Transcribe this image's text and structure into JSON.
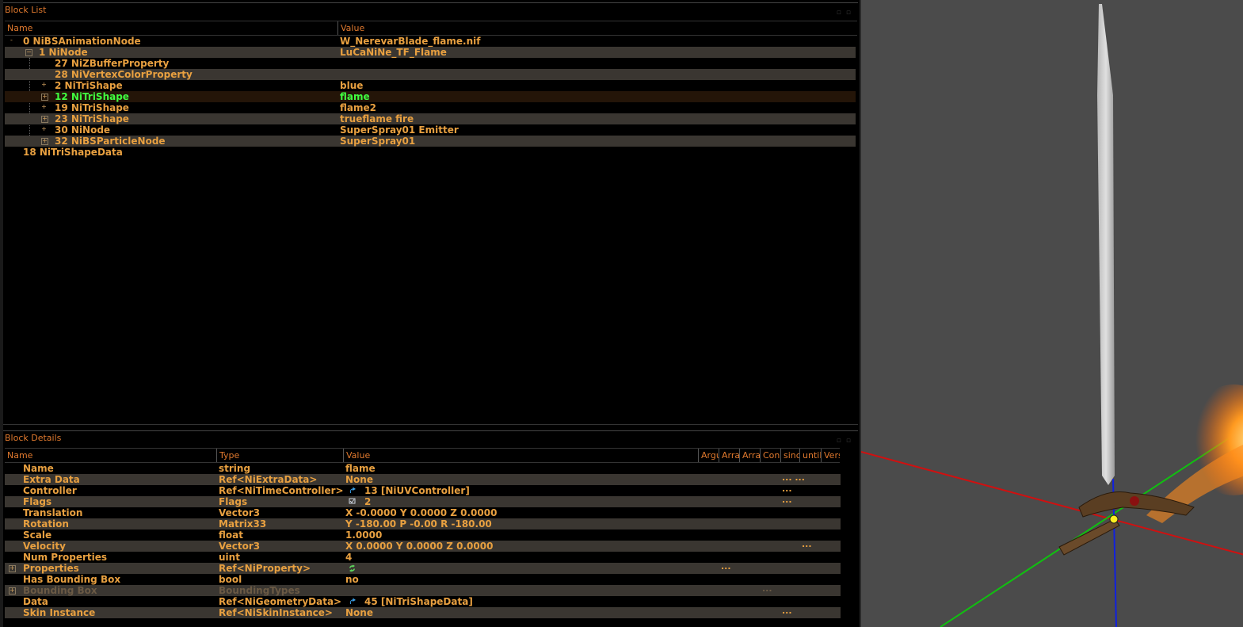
{
  "block_list": {
    "title": "Block List",
    "columns": {
      "name": "Name",
      "value": "Value"
    },
    "rows": [
      {
        "name": "0 NiBSAnimationNode",
        "value": "W_NerevarBlade_flame.nif"
      },
      {
        "name": "1 NiNode",
        "value": "LuCaNiNe_TF_Flame"
      },
      {
        "name": "27 NiZBufferProperty",
        "value": ""
      },
      {
        "name": "28 NiVertexColorProperty",
        "value": ""
      },
      {
        "name": "2 NiTriShape",
        "value": "blue"
      },
      {
        "name": "12 NiTriShape",
        "value": "flame"
      },
      {
        "name": "19 NiTriShape",
        "value": "flame2"
      },
      {
        "name": "23 NiTriShape",
        "value": "trueflame fire"
      },
      {
        "name": "30 NiNode",
        "value": "SuperSpray01 Emitter"
      },
      {
        "name": "32 NiBSParticleNode",
        "value": "SuperSpray01"
      },
      {
        "name": "18 NiTriShapeData",
        "value": ""
      }
    ]
  },
  "block_details": {
    "title": "Block Details",
    "columns": {
      "name": "Name",
      "type": "Type",
      "value": "Value",
      "arg": "Argu",
      "arr1": "Arra",
      "arr2": "Arra",
      "cond": "Con",
      "since": "sinc",
      "until": "until",
      "vers": "Vers"
    },
    "rows": [
      {
        "name": "Name",
        "type": "string",
        "value": "flame",
        "dots": ""
      },
      {
        "name": "Extra Data",
        "type": "Ref<NiExtraData>",
        "value": "None",
        "dots": "...   ..."
      },
      {
        "name": "Controller",
        "type": "Ref<NiTimeController>",
        "value": "13 [NiUVController]",
        "dots": "..."
      },
      {
        "name": "Flags",
        "type": "Flags",
        "value": "2",
        "dots": "..."
      },
      {
        "name": "Translation",
        "type": "Vector3",
        "value": "X -0.0000 Y 0.0000 Z 0.0000",
        "dots": ""
      },
      {
        "name": "Rotation",
        "type": "Matrix33",
        "value": "Y -180.00 P -0.00 R -180.00",
        "dots": ""
      },
      {
        "name": "Scale",
        "type": "float",
        "value": "1.0000",
        "dots": ""
      },
      {
        "name": "Velocity",
        "type": "Vector3",
        "value": "X 0.0000 Y 0.0000 Z 0.0000",
        "dots": "..."
      },
      {
        "name": "Num Properties",
        "type": "uint",
        "value": "4",
        "dots": ""
      },
      {
        "name": "Properties",
        "type": "Ref<NiProperty>",
        "value": "",
        "dots": "..."
      },
      {
        "name": "Has Bounding Box",
        "type": "bool",
        "value": "no",
        "dots": ""
      },
      {
        "name": "Bounding Box",
        "type": "BoundingTypes",
        "value": "",
        "dots": "..."
      },
      {
        "name": "Data",
        "type": "Ref<NiGeometryData>",
        "value": "45 [NiTriShapeData]",
        "dots": ""
      },
      {
        "name": "Skin Instance",
        "type": "Ref<NiSkinInstance>",
        "value": "None",
        "dots": "..."
      }
    ]
  },
  "colors": {
    "text": "#e8a040",
    "header": "#e0792e",
    "selected_text": "#40ff40",
    "alt_row": "#3a3631",
    "viewport_bg": "#4b4b4b"
  }
}
